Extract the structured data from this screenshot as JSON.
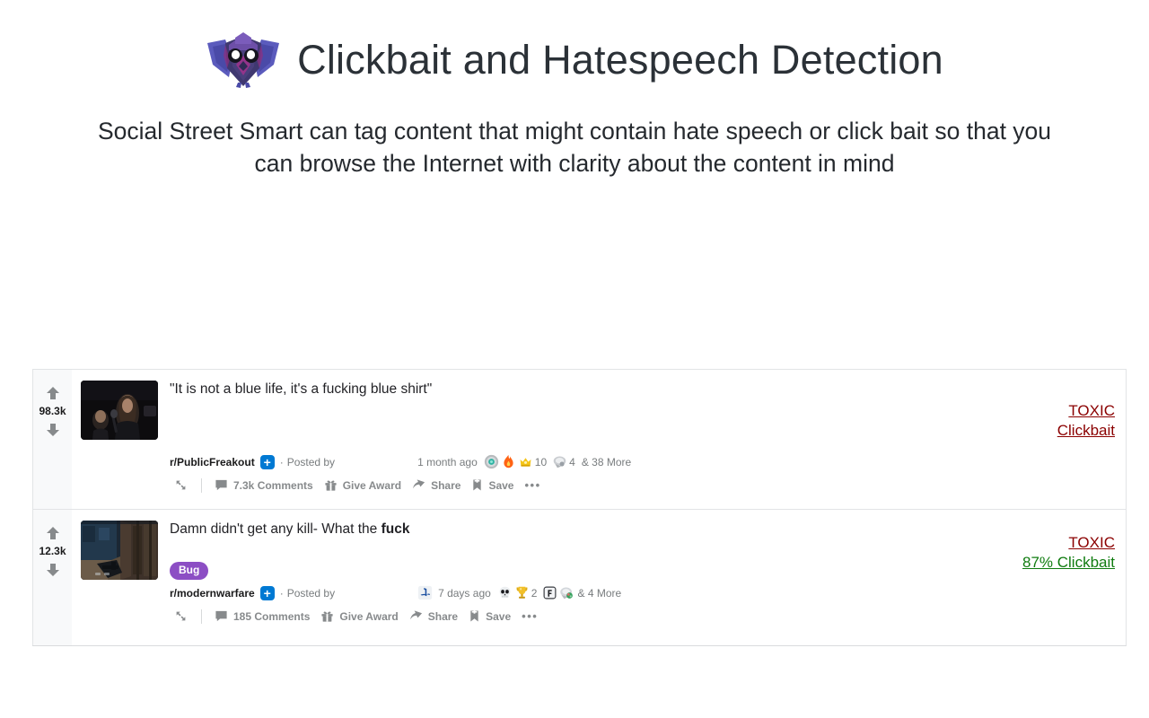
{
  "header": {
    "logo_name": "owl-logo",
    "title": "Clickbait and Hatespeech Detection",
    "subtitle": "Social Street Smart can tag content that might contain hate speech or click bait so that you can browse the Internet with clarity about the content in mind"
  },
  "colors": {
    "toxic": "#8b0000",
    "clickbait_green": "#107c10",
    "flair_purple": "#8c4ec4",
    "badge_blue": "#0079d3",
    "vote_gray": "#878a8c"
  },
  "actions": {
    "give_award": "Give Award",
    "share": "Share",
    "save": "Save",
    "ellipsis": "•••"
  },
  "posts": [
    {
      "votes": "98.3k",
      "title": "\"It is not a blue life, it's a fucking blue shirt\"",
      "title_bold": "",
      "flair": null,
      "subreddit": "r/PublicFreakout",
      "plus_badge": "+",
      "separator": "·",
      "posted_by": "Posted by",
      "username": "",
      "platform_icon": null,
      "timestamp": "1 month ago",
      "awards": [
        {
          "icon": "silver-award-icon",
          "count": ""
        },
        {
          "icon": "fire-award-icon",
          "count": ""
        },
        {
          "icon": "gold-crown-award-icon",
          "count": "10"
        },
        {
          "icon": "helpful-award-icon",
          "count": "4"
        }
      ],
      "more_awards": "& 38 More",
      "comments": "7.3k Comments",
      "tags": [
        {
          "text": "TOXIC",
          "style": "toxic"
        },
        {
          "text": "Clickbait",
          "style": "clickbait-red"
        }
      ],
      "thumbnail_name": "post-thumbnail-public-freakout"
    },
    {
      "votes": "12.3k",
      "title": "Damn didn't get any kill- What the ",
      "title_bold": "fuck",
      "flair": "Bug",
      "subreddit": "r/modernwarfare",
      "plus_badge": "+",
      "separator": "·",
      "posted_by": "Posted by",
      "username": "",
      "platform_icon": "playstation-icon",
      "timestamp": "7 days ago",
      "awards": [
        {
          "icon": "skull-award-icon",
          "count": ""
        },
        {
          "icon": "gold-trophy-award-icon",
          "count": "2"
        },
        {
          "icon": "f-key-award-icon",
          "count": ""
        },
        {
          "icon": "wholesome-award-icon",
          "count": ""
        }
      ],
      "more_awards": "& 4 More",
      "comments": "185 Comments",
      "tags": [
        {
          "text": "TOXIC",
          "style": "toxic"
        },
        {
          "text": "87% Clickbait",
          "style": "clickbait-green"
        }
      ],
      "thumbnail_name": "post-thumbnail-modernwarfare"
    }
  ]
}
